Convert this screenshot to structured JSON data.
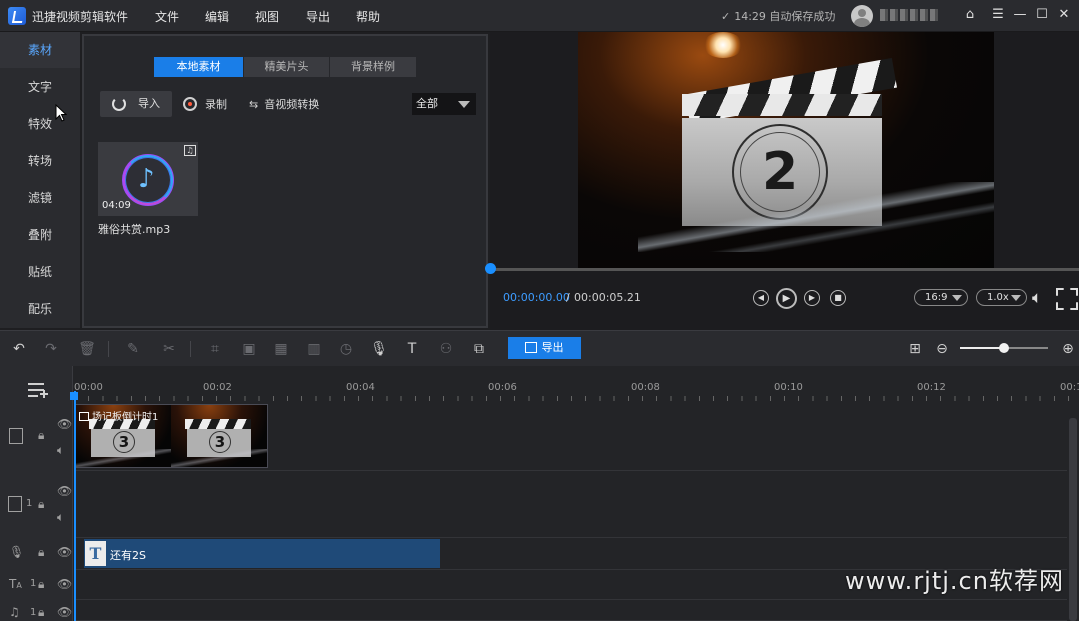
{
  "app": {
    "title": "迅捷视频剪辑软件",
    "menu": [
      "文件",
      "编辑",
      "视图",
      "导出",
      "帮助"
    ],
    "autosave": "14:29 自动保存成功",
    "accent": "#1a7ee8"
  },
  "sidebar": {
    "items": [
      {
        "label": "素材"
      },
      {
        "label": "文字"
      },
      {
        "label": "特效"
      },
      {
        "label": "转场"
      },
      {
        "label": "滤镜"
      },
      {
        "label": "叠附"
      },
      {
        "label": "贴纸"
      },
      {
        "label": "配乐"
      }
    ],
    "active_index": 0
  },
  "media_panel": {
    "tabs": [
      "本地素材",
      "精美片头",
      "背景样例"
    ],
    "active_tab": 0,
    "import_label": "导入",
    "record_label": "录制",
    "convert_label": "音视频转换",
    "filter_value": "全部",
    "items": [
      {
        "name": "雅俗共赏.mp3",
        "duration": "04:09",
        "icon": "music-note-icon"
      }
    ]
  },
  "preview": {
    "countdown_digit": "2",
    "time_current": "00:00:00.00",
    "time_separator": "/",
    "time_total": "00:00:05.21",
    "aspect_ratio": "16:9",
    "speed": "1.0x",
    "progress": 0
  },
  "toolbar": {
    "export_label": "导出",
    "zoom_level": 0.5
  },
  "timeline": {
    "ruler_labels": [
      "00:00",
      "00:02",
      "00:04",
      "00:06",
      "00:08",
      "00:10",
      "00:12",
      "00:1"
    ],
    "video_clip_label": "场记板倒计时1",
    "video_clip_digits": [
      "3",
      "3"
    ],
    "text_clip_label": "还有2S",
    "text_clip_icon": "T",
    "track_numbers": [
      "1",
      "1",
      "1"
    ]
  },
  "watermark": "www.rjtj.cn软荐网"
}
